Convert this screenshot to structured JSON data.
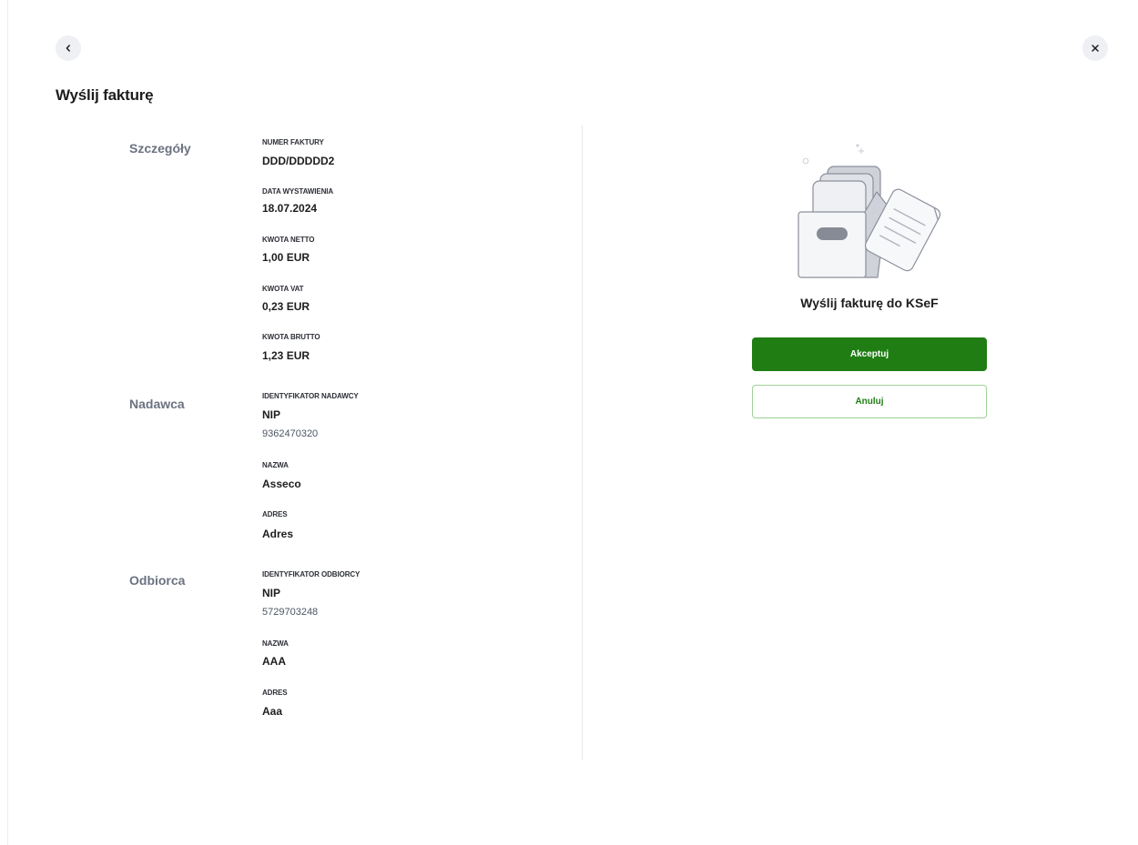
{
  "header": {
    "back_icon": "chevron-left-icon",
    "close_icon": "close-icon",
    "title": "Wyślij fakturę"
  },
  "details": {
    "section_label": "Szczegóły",
    "invoice_number_label": "NUMER FAKTURY",
    "invoice_number": "DDD/DDDDD2",
    "issue_date_label": "DATA WYSTAWIENIA",
    "issue_date": "18.07.2024",
    "net_amount_label": "KWOTA NETTO",
    "net_amount": "1,00 EUR",
    "vat_amount_label": "KWOTA VAT",
    "vat_amount": "0,23 EUR",
    "gross_amount_label": "KWOTA BRUTTO",
    "gross_amount": "1,23 EUR"
  },
  "sender": {
    "section_label": "Nadawca",
    "id_label": "IDENTYFIKATOR NADAWCY",
    "id_type": "NIP",
    "id_value": "9362470320",
    "name_label": "NAZWA",
    "name": "Asseco",
    "address_label": "ADRES",
    "address": "Adres"
  },
  "recipient": {
    "section_label": "Odbiorca",
    "id_label": "IDENTYFIKATOR ODBIORCY",
    "id_type": "NIP",
    "id_value": "5729703248",
    "name_label": "NAZWA",
    "name": "AAA",
    "address_label": "ADRES",
    "address": "Aaa"
  },
  "action_panel": {
    "illustration": "invoice-box-illustration",
    "heading": "Wyślij fakturę do KSeF",
    "accept_label": "Akceptuj",
    "cancel_label": "Anuluj"
  },
  "colors": {
    "accent": "#1f7d13",
    "section_label": "#6b7280",
    "text": "#1d1d1f"
  }
}
